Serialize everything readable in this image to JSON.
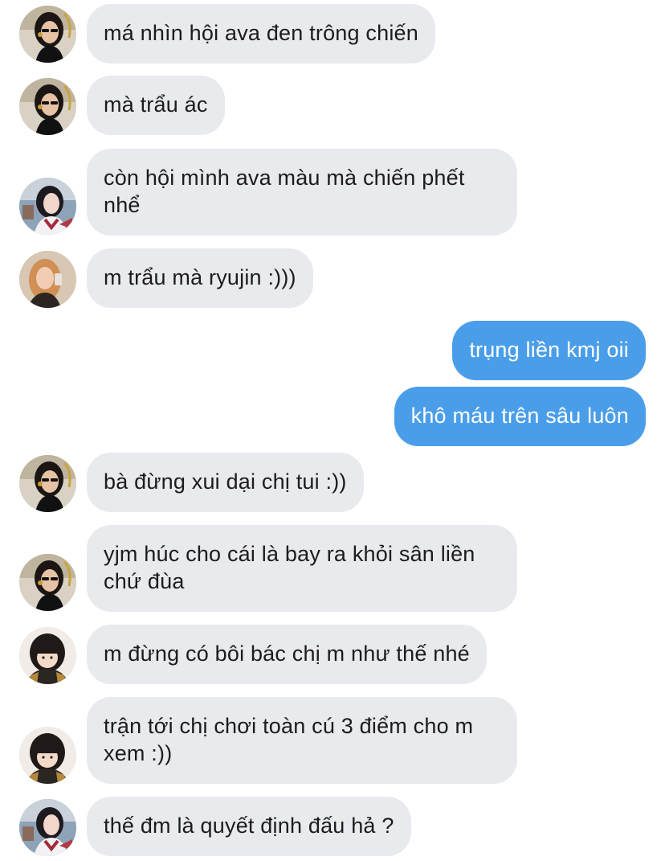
{
  "messages": [
    {
      "text": "má nhìn hội ava đen trông chiến",
      "from": "in",
      "avatar": "avatar-sunglasses-dark-hair"
    },
    {
      "text": "mà trẩu ác",
      "from": "in",
      "avatar": "avatar-sunglasses-dark-hair"
    },
    {
      "text": "còn hội mình ava màu mà chiến phết nhể",
      "from": "in",
      "avatar": "avatar-dark-hair-sailor-outfit"
    },
    {
      "text": "m trẩu mà ryujin :)))",
      "from": "in",
      "avatar": "avatar-blonde-hair-mirror-selfie"
    },
    {
      "text": "trụng liền kmj oii",
      "from": "out"
    },
    {
      "text": "khô máu trên sâu luôn",
      "from": "out"
    },
    {
      "text": "bà đừng xui dại chị tui :))",
      "from": "in",
      "avatar": "avatar-sunglasses-dark-hair"
    },
    {
      "text": "yjm húc cho cái là bay ra khỏi sân liền chứ đùa",
      "from": "in",
      "avatar": "avatar-sunglasses-dark-hair"
    },
    {
      "text": "m đừng có bôi bác chị m như thế nhé",
      "from": "in",
      "avatar": "avatar-bangs-headphones"
    },
    {
      "text": "trận tới chị chơi toàn cú 3 điểm cho m xem :))",
      "from": "in",
      "avatar": "avatar-bangs-headphones"
    },
    {
      "text": "thế đm là quyết định đấu hả ?",
      "from": "in",
      "avatar": "avatar-dark-hair-sailor-outfit"
    }
  ],
  "colors": {
    "incoming_bubble": "#e9eaee",
    "outgoing_bubble": "#4a9ee9",
    "incoming_text": "#1c1c1e",
    "outgoing_text": "#ffffff"
  }
}
